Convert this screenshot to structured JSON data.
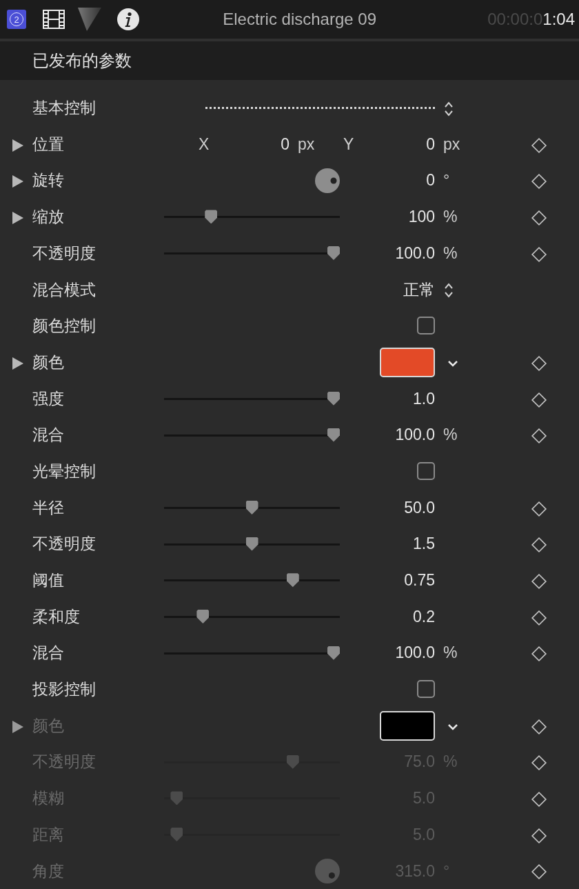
{
  "header": {
    "badge": "2",
    "title": "Electric discharge 09",
    "timecode_dim": "00:00:0",
    "timecode": "1:04"
  },
  "section": {
    "title": "已发布的参数"
  },
  "rows": [
    {
      "kind": "menu",
      "label": "基本控制",
      "expandable": false,
      "disabled": false,
      "keyframe_button": false
    },
    {
      "kind": "position",
      "label": "位置",
      "expandable": true,
      "disabled": false,
      "keyframe_button": true,
      "x_label": "X",
      "x_value": "0",
      "x_unit": "px",
      "y_label": "Y",
      "y_value": "0",
      "y_unit": "px"
    },
    {
      "kind": "dial",
      "label": "旋转",
      "expandable": true,
      "disabled": false,
      "keyframe_button": true,
      "value": "0",
      "unit": "°"
    },
    {
      "kind": "slider",
      "label": "缩放",
      "expandable": true,
      "disabled": false,
      "keyframe_button": true,
      "level": 0.25,
      "value": "100",
      "unit": "%"
    },
    {
      "kind": "slider",
      "label": "不透明度",
      "expandable": false,
      "disabled": false,
      "keyframe_button": true,
      "level": 1,
      "value": "100.0",
      "unit": "%"
    },
    {
      "kind": "popup",
      "label": "混合模式",
      "expandable": false,
      "disabled": false,
      "keyframe_button": false,
      "value": "正常"
    },
    {
      "kind": "checkbox",
      "label": "颜色控制",
      "expandable": false,
      "disabled": false,
      "keyframe_button": false,
      "checked": false
    },
    {
      "kind": "color",
      "label": "颜色",
      "expandable": true,
      "disabled": false,
      "keyframe_button": true,
      "color": "#e34a27"
    },
    {
      "kind": "slider",
      "label": "强度",
      "expandable": false,
      "disabled": false,
      "keyframe_button": true,
      "level": 1,
      "value": "1.0"
    },
    {
      "kind": "slider",
      "label": "混合",
      "expandable": false,
      "disabled": false,
      "keyframe_button": true,
      "level": 1,
      "value": "100.0",
      "unit": "%"
    },
    {
      "kind": "checkbox",
      "label": "光晕控制",
      "expandable": false,
      "disabled": false,
      "keyframe_button": false,
      "checked": false
    },
    {
      "kind": "slider",
      "label": "半径",
      "expandable": false,
      "disabled": false,
      "keyframe_button": true,
      "level": 0.5,
      "value": "50.0"
    },
    {
      "kind": "slider",
      "label": "不透明度",
      "expandable": false,
      "disabled": false,
      "keyframe_button": true,
      "level": 0.5,
      "value": "1.5"
    },
    {
      "kind": "slider",
      "label": "阈值",
      "expandable": false,
      "disabled": false,
      "keyframe_button": true,
      "level": 0.75,
      "value": "0.75"
    },
    {
      "kind": "slider",
      "label": "柔和度",
      "expandable": false,
      "disabled": false,
      "keyframe_button": true,
      "level": 0.2,
      "value": "0.2"
    },
    {
      "kind": "slider",
      "label": "混合",
      "expandable": false,
      "disabled": false,
      "keyframe_button": true,
      "level": 1,
      "value": "100.0",
      "unit": "%"
    },
    {
      "kind": "checkbox",
      "label": "投影控制",
      "expandable": false,
      "disabled": false,
      "keyframe_button": false,
      "checked": false
    },
    {
      "kind": "color",
      "label": "颜色",
      "expandable": true,
      "disabled": true,
      "keyframe_button": true,
      "color": "#000000"
    },
    {
      "kind": "slider",
      "label": "不透明度",
      "expandable": false,
      "disabled": true,
      "keyframe_button": true,
      "level": 0.75,
      "value": "75.0",
      "unit": "%"
    },
    {
      "kind": "slider",
      "label": "模糊",
      "expandable": false,
      "disabled": true,
      "keyframe_button": true,
      "level": 0.04,
      "value": "5.0"
    },
    {
      "kind": "slider",
      "label": "距离",
      "expandable": false,
      "disabled": true,
      "keyframe_button": true,
      "level": 0.04,
      "value": "5.0"
    },
    {
      "kind": "dial",
      "label": "角度",
      "expandable": false,
      "disabled": true,
      "keyframe_button": true,
      "value": "315.0",
      "unit": "°"
    }
  ]
}
